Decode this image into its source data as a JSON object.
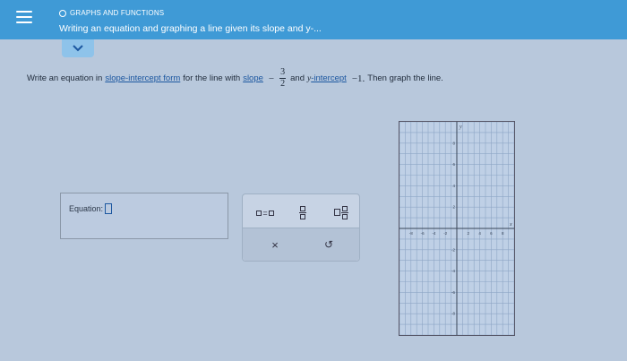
{
  "header": {
    "category": "GRAPHS AND FUNCTIONS",
    "title": "Writing an equation and graphing a line given its slope and y-..."
  },
  "question": {
    "prefix": "Write an equation in",
    "link1": "slope-intercept form",
    "mid1": "for the line with",
    "link2": "slope",
    "slope_sign": "−",
    "slope_num": "3",
    "slope_den": "2",
    "mid2": "and",
    "y_var": "y",
    "link3": "-intercept",
    "intercept": "−1.",
    "suffix": "Then graph the line."
  },
  "equation": {
    "label": "Equation:"
  },
  "toolbox": {
    "eq_symbol": "=",
    "clear_symbol": "×",
    "undo_symbol": "↺"
  },
  "graph": {
    "y_axis_label": "y",
    "x_range": [
      -10,
      10
    ],
    "y_range": [
      -10,
      10
    ],
    "x_ticks": [
      "-8",
      "-6",
      "-4",
      "-2",
      "2",
      "4",
      "6",
      "8"
    ],
    "y_ticks": [
      "8",
      "6",
      "4",
      "2",
      "-2",
      "-4",
      "-6",
      "-8"
    ],
    "x_axis_label": "x"
  },
  "colors": {
    "header": "#3f9ad6",
    "link": "#1c57a0"
  }
}
